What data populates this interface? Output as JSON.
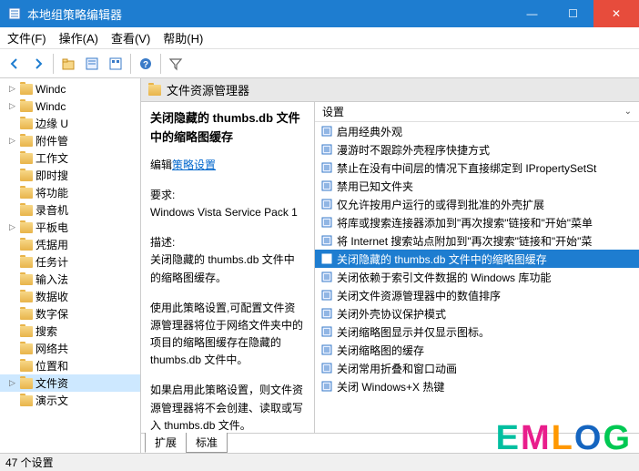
{
  "window": {
    "title": "本地组策略编辑器",
    "min_icon": "—",
    "max_icon": "☐",
    "close_icon": "✕"
  },
  "menubar": {
    "file": "文件(F)",
    "action": "操作(A)",
    "view": "查看(V)",
    "help": "帮助(H)"
  },
  "tree": {
    "items": [
      {
        "label": "Windc",
        "exp": "▷"
      },
      {
        "label": "Windc",
        "exp": "▷"
      },
      {
        "label": "边缘 U",
        "exp": ""
      },
      {
        "label": "附件管",
        "exp": "▷"
      },
      {
        "label": "工作文",
        "exp": ""
      },
      {
        "label": "即时搜",
        "exp": ""
      },
      {
        "label": "将功能",
        "exp": ""
      },
      {
        "label": "录音机",
        "exp": ""
      },
      {
        "label": "平板电",
        "exp": "▷"
      },
      {
        "label": "凭据用",
        "exp": ""
      },
      {
        "label": "任务计",
        "exp": ""
      },
      {
        "label": "输入法",
        "exp": ""
      },
      {
        "label": "数据收",
        "exp": ""
      },
      {
        "label": "数字保",
        "exp": ""
      },
      {
        "label": "搜索",
        "exp": ""
      },
      {
        "label": "网络共",
        "exp": ""
      },
      {
        "label": "位置和",
        "exp": ""
      },
      {
        "label": "文件资",
        "exp": "▷",
        "selected": true
      },
      {
        "label": "演示文",
        "exp": ""
      }
    ]
  },
  "detail": {
    "header": "文件资源管理器",
    "policy_title": "关闭隐藏的 thumbs.db 文件中的缩略图缓存",
    "edit_label": "编辑",
    "edit_link": "策略设置",
    "req_label": "要求:",
    "req_value": "Windows Vista Service Pack 1",
    "desc_label": "描述:",
    "desc_text1": "关闭隐藏的 thumbs.db 文件中的缩略图缓存。",
    "desc_text2": "使用此策略设置,可配置文件资源管理器将位于网络文件夹中的项目的缩略图缓存在隐藏的 thumbs.db 文件中。",
    "desc_text3": "如果启用此策略设置，则文件资源管理器将不会创建、读取或写入 thumbs.db 文件。"
  },
  "settings": {
    "header": "设置",
    "items": [
      "启用经典外观",
      "漫游时不跟踪外壳程序快捷方式",
      "禁止在没有中间层的情况下直接绑定到 IPropertySetSt",
      "禁用已知文件夹",
      "仅允许按用户运行的或得到批准的外壳扩展",
      "将库或搜索连接器添加到\"再次搜索\"链接和\"开始\"菜单",
      "将 Internet 搜索站点附加到\"再次搜索\"链接和\"开始\"菜",
      "关闭隐藏的 thumbs.db 文件中的缩略图缓存",
      "关闭依赖于索引文件数据的 Windows 库功能",
      "关闭文件资源管理器中的数值排序",
      "关闭外壳协议保护模式",
      "关闭缩略图显示并仅显示图标。",
      "关闭缩略图的缓存",
      "关闭常用折叠和窗口动画",
      "关闭 Windows+X 热键"
    ],
    "selected_index": 7
  },
  "tabs": {
    "extended": "扩展",
    "standard": "标准"
  },
  "statusbar": {
    "text": "47 个设置"
  },
  "watermark": [
    "E",
    "M",
    "L",
    "O",
    "G"
  ]
}
